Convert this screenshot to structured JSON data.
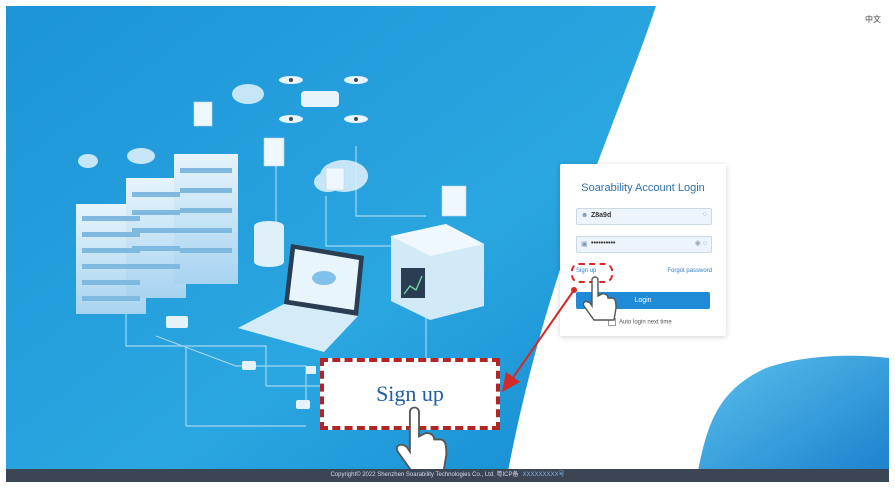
{
  "language_switch": "中文",
  "login": {
    "title": "Soarability Account Login",
    "username_value": "Z8a9d",
    "password_value": "••••••••••",
    "signup_label": "Sign up",
    "forgot_label": "Forgot password",
    "login_button_label": "Login",
    "auto_login_label": "Auto login next time"
  },
  "callout": {
    "label": "Sign up"
  },
  "footer": {
    "copyright": "Copyright© 2022 Shenzhen Soarability Technologies Co., Ltd. 粤ICP备",
    "icp": "XXXXXXXXX号"
  },
  "colors": {
    "accent": "#1f8ad6",
    "highlight": "#d42a2a",
    "banner": "#1a8fd2"
  }
}
